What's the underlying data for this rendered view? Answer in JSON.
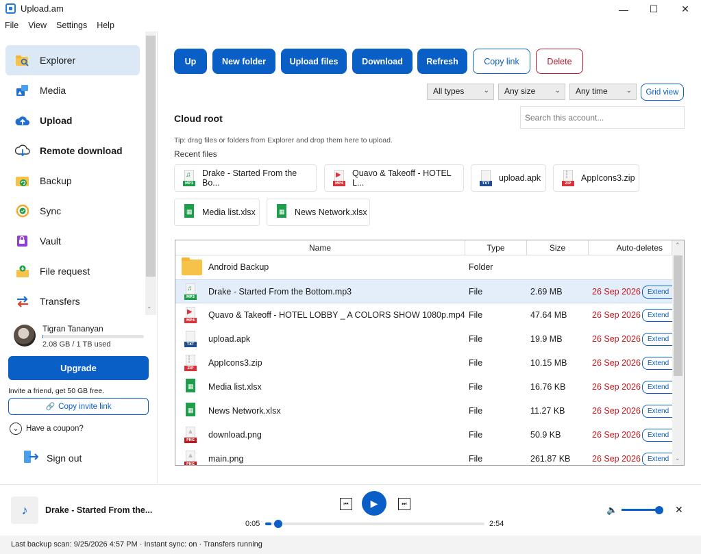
{
  "window": {
    "title": "Upload.am",
    "minimize": "—",
    "maximize": "☐",
    "close": "✕"
  },
  "menu": [
    "File",
    "View",
    "Settings",
    "Help"
  ],
  "sidebar": {
    "items": [
      {
        "label": "Explorer"
      },
      {
        "label": "Media"
      },
      {
        "label": "Upload"
      },
      {
        "label": "Remote download"
      },
      {
        "label": "Backup"
      },
      {
        "label": "Sync"
      },
      {
        "label": "Vault"
      },
      {
        "label": "File request"
      },
      {
        "label": "Transfers"
      }
    ],
    "user": {
      "name": "Tigran Tananyan",
      "quota": "2.08 GB / 1 TB used",
      "quota_fraction": 0.002
    },
    "upgrade": "Upgrade",
    "invite_text": "Invite a friend, get 50 GB free.",
    "invite_button": "Copy invite link",
    "coupon": "Have a coupon?",
    "signout": "Sign out"
  },
  "toolbar": {
    "up": "Up",
    "new_folder": "New folder",
    "upload_files": "Upload files",
    "download": "Download",
    "refresh": "Refresh",
    "copy_link": "Copy link",
    "delete": "Delete"
  },
  "filters": {
    "type": "All types",
    "size": "Any size",
    "time": "Any time",
    "grid_view": "Grid view"
  },
  "location": "Cloud root",
  "search": {
    "placeholder": "Search this account..."
  },
  "tip": "Tip: drag files or folders from Explorer and drop them here to upload.",
  "recent": {
    "label": "Recent files",
    "items": [
      {
        "name": "Drake - Started From the Bo...",
        "kind": "mp3"
      },
      {
        "name": "Quavo & Takeoff - HOTEL L...",
        "kind": "mp4"
      },
      {
        "name": "upload.apk",
        "kind": "apk"
      },
      {
        "name": "AppIcons3.zip",
        "kind": "zip"
      },
      {
        "name": "Media list.xlsx",
        "kind": "xlsx"
      },
      {
        "name": "News Network.xlsx",
        "kind": "xlsx"
      }
    ]
  },
  "table": {
    "headers": {
      "name": "Name",
      "type": "Type",
      "size": "Size",
      "autodel": "Auto-deletes"
    },
    "extend_label": "Extend",
    "rows": [
      {
        "name": "Android Backup",
        "type": "Folder",
        "size": "",
        "autodel": "",
        "kind": "folder"
      },
      {
        "name": "Drake - Started From the Bottom.mp3",
        "type": "File",
        "size": "2.69 MB",
        "autodel": "26 Sep 2026",
        "kind": "mp3"
      },
      {
        "name": "Quavo & Takeoff - HOTEL LOBBY _ A COLORS SHOW 1080p.mp4",
        "type": "File",
        "size": "47.64 MB",
        "autodel": "26 Sep 2026",
        "kind": "mp4"
      },
      {
        "name": "upload.apk",
        "type": "File",
        "size": "19.9 MB",
        "autodel": "26 Sep 2026",
        "kind": "apk"
      },
      {
        "name": "AppIcons3.zip",
        "type": "File",
        "size": "10.15 MB",
        "autodel": "26 Sep 2026",
        "kind": "zip"
      },
      {
        "name": "Media list.xlsx",
        "type": "File",
        "size": "16.76 KB",
        "autodel": "26 Sep 2026",
        "kind": "xlsx"
      },
      {
        "name": "News Network.xlsx",
        "type": "File",
        "size": "11.27 KB",
        "autodel": "26 Sep 2026",
        "kind": "xlsx"
      },
      {
        "name": "download.png",
        "type": "File",
        "size": "50.9 KB",
        "autodel": "26 Sep 2026",
        "kind": "png"
      },
      {
        "name": "main.png",
        "type": "File",
        "size": "261.87 KB",
        "autodel": "26 Sep 2026",
        "kind": "png"
      }
    ]
  },
  "player": {
    "title": "Drake - Started From the...",
    "elapsed": "0:05",
    "duration": "2:54",
    "progress_fraction": 0.029,
    "volume_fraction": 1.0
  },
  "status": "Last backup scan: 9/25/2026 4:57 PM  ·  Instant sync: on  ·  Transfers running",
  "colors": {
    "accent": "#0a5fc7",
    "danger": "#b2182b",
    "expiry": "#c4161c",
    "selected_row": "#e3eefa"
  }
}
